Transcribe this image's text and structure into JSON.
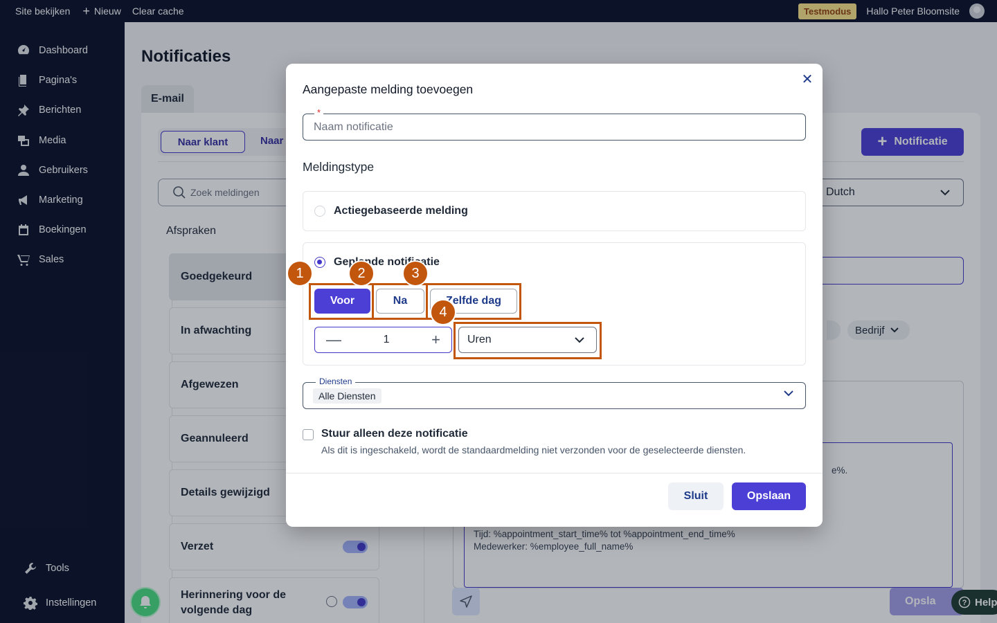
{
  "topbar": {
    "view_site": "Site bekijken",
    "new": "Nieuw",
    "clear_cache": "Clear cache",
    "test_mode": "Testmodus",
    "greeting": "Hallo Peter Bloomsite"
  },
  "sidebar": {
    "items": [
      {
        "label": "Dashboard",
        "icon": "dashboard-icon"
      },
      {
        "label": "Pagina's",
        "icon": "pages-icon"
      },
      {
        "label": "Berichten",
        "icon": "pin-icon"
      },
      {
        "label": "Media",
        "icon": "media-icon"
      },
      {
        "label": "Gebruikers",
        "icon": "user-icon"
      },
      {
        "label": "Marketing",
        "icon": "megaphone-icon"
      },
      {
        "label": "Boekingen",
        "icon": "calendar-icon"
      },
      {
        "label": "Sales",
        "icon": "cart-icon"
      }
    ],
    "bottom": [
      {
        "label": "Tools",
        "icon": "wrench-icon"
      },
      {
        "label": "Instellingen",
        "icon": "gear-icon"
      }
    ]
  },
  "main": {
    "title": "Notificaties",
    "tab": "E-mail",
    "seg_a": "Naar klant",
    "seg_b": "Naar",
    "add_button": "Notificatie",
    "search_placeholder": "Zoek meldingen",
    "language": "Dutch",
    "group_label": "Afspraken",
    "statuses": [
      "Goedgekeurd",
      "In afwachting",
      "Afgewezen",
      "Geannuleerd",
      "Details gewijzigd",
      "Verzet",
      "Herinnering voor de volgende dag"
    ],
    "filter_chip": "Bedrijf",
    "editor_fragment": "e%.",
    "editor_line1": "Tijd: %appointment_start_time% tot %appointment_end_time%",
    "editor_line2": "Medewerker: %employee_full_name%",
    "save_ghost": "Opsla",
    "help": "Help"
  },
  "modal": {
    "title": "Aangepaste melding toevoegen",
    "name_placeholder": "Naam notificatie",
    "required_mark": "*",
    "type_title": "Meldingstype",
    "option_action": "Actiegebaseerde melding",
    "option_scheduled": "Geplande notificatie",
    "timing": {
      "before": "Voor",
      "after": "Na",
      "same_day": "Zelfde dag"
    },
    "amount": "1",
    "unit": "Uren",
    "services_label": "Diensten",
    "services_value": "Alle Diensten",
    "only_this_label": "Stuur alleen deze notificatie",
    "only_this_help": "Als dit is ingeschakeld, wordt de standaardmelding niet verzonden voor de geselecteerde diensten.",
    "close_button": "Sluit",
    "save_button": "Opslaan"
  },
  "annotations": [
    "1",
    "2",
    "3",
    "4"
  ],
  "colors": {
    "accent": "#4c3fd6",
    "annotation": "#c2560c",
    "sidebar": "#0b1028"
  }
}
